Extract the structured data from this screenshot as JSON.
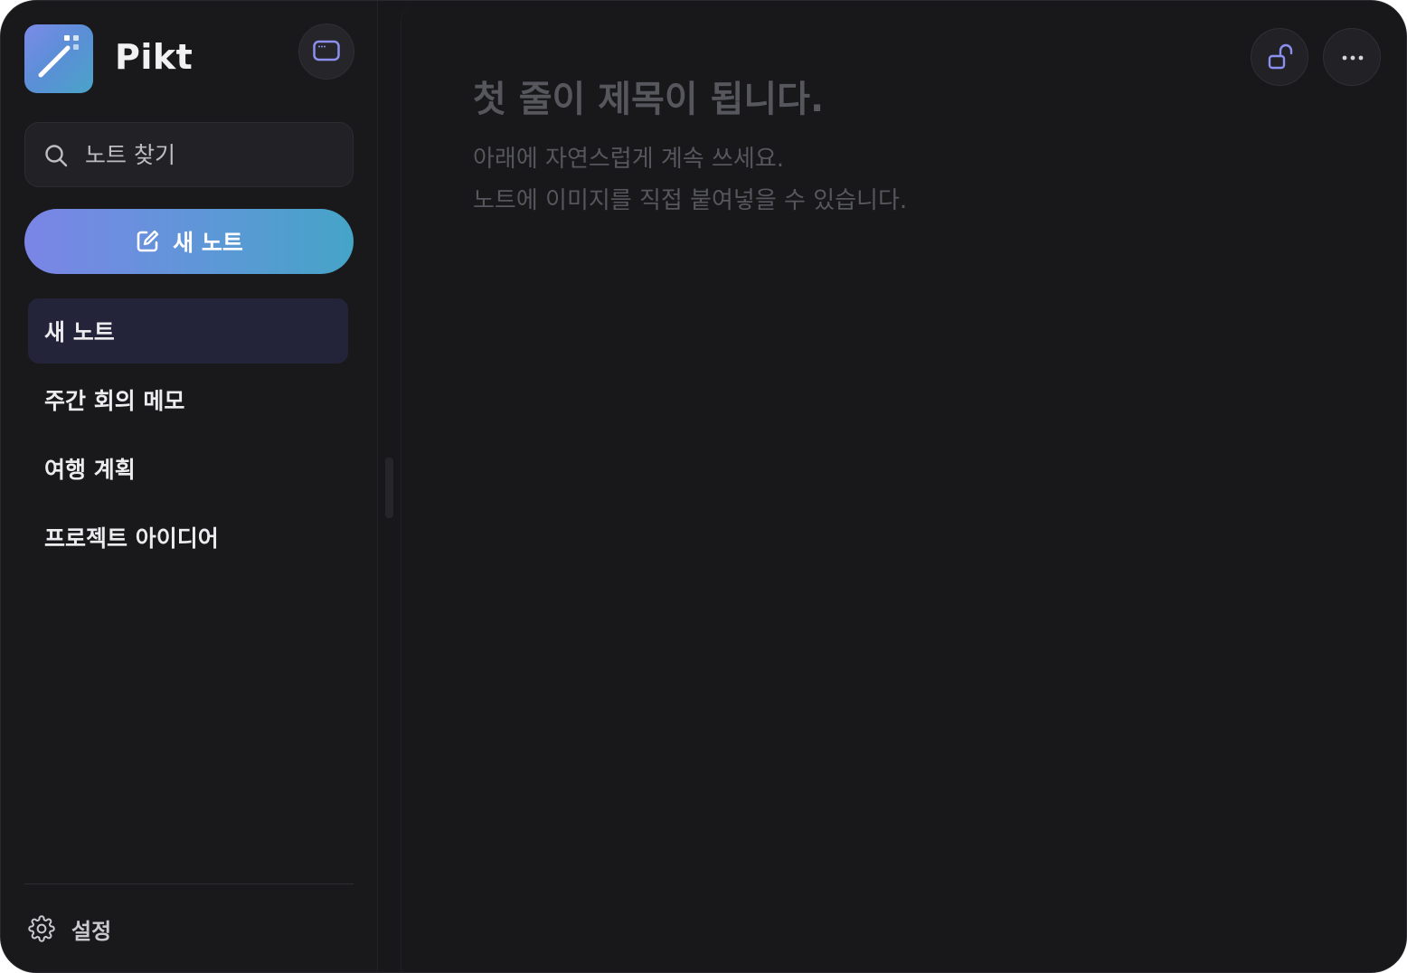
{
  "app": {
    "name": "Pikt"
  },
  "search": {
    "placeholder": "노트 찾기",
    "value": ""
  },
  "new_note_button": {
    "label": "새 노트"
  },
  "notes": [
    {
      "title": "새 노트",
      "active": true
    },
    {
      "title": "주간 회의 메모",
      "active": false
    },
    {
      "title": "여행 계획",
      "active": false
    },
    {
      "title": "프로젝트 아이디어",
      "active": false
    }
  ],
  "settings": {
    "label": "설정"
  },
  "editor": {
    "title_placeholder": "첫 줄이 제목이 됩니다.",
    "body_placeholder_line1": "아래에 자연스럽게 계속 쓰세요.",
    "body_placeholder_line2": "노트에 이미지를 직접 붙여넣을 수 있습니다."
  },
  "icons": {
    "logo": "pen-sparkle-icon",
    "window_toggle": "window-icon",
    "search": "search-icon",
    "new_note": "edit-icon",
    "settings": "gear-icon",
    "lock": "unlock-icon",
    "more": "more-horizontal-icon"
  },
  "colors": {
    "background": "#18181b",
    "accent_start": "#7b85e6",
    "accent_end": "#45a4c7",
    "icon_accent": "#8b8ff0",
    "active_item": "#23243a",
    "placeholder_text": "#56565d"
  }
}
